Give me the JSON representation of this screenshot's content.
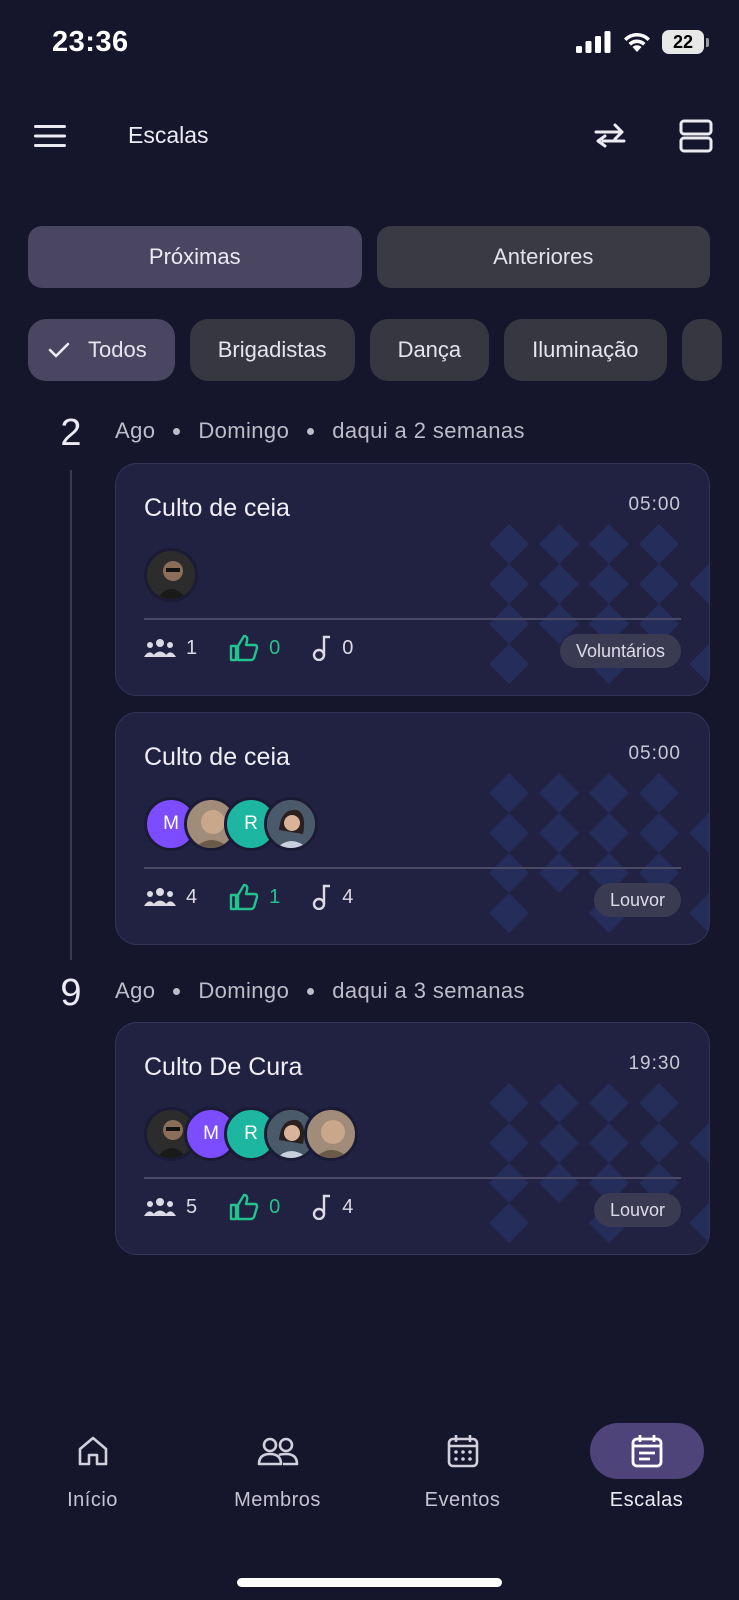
{
  "status_bar": {
    "time": "23:36",
    "battery": "22"
  },
  "app_bar": {
    "title": "Escalas"
  },
  "segments": [
    {
      "label": "Próximas",
      "active": true
    },
    {
      "label": "Anteriores",
      "active": false
    }
  ],
  "chips": [
    {
      "label": "Todos",
      "selected": true
    },
    {
      "label": "Brigadistas",
      "selected": false
    },
    {
      "label": "Dança",
      "selected": false
    },
    {
      "label": "Iluminação",
      "selected": false
    }
  ],
  "groups": [
    {
      "day": "2",
      "month": "Ago",
      "weekday": "Domingo",
      "relative": "daqui a 2 semanas",
      "cards": [
        {
          "title": "Culto de ceia",
          "time": "05:00",
          "avatars": [
            {
              "type": "photo",
              "initial": "",
              "color": "#3b3b3b"
            }
          ],
          "members": "1",
          "likes": "0",
          "songs": "0",
          "team": "Voluntários"
        },
        {
          "title": "Culto de ceia",
          "time": "05:00",
          "avatars": [
            {
              "type": "initial",
              "initial": "M",
              "color": "#7c4dff"
            },
            {
              "type": "photo",
              "initial": "",
              "color": "#8b7a6a"
            },
            {
              "type": "initial",
              "initial": "R",
              "color": "#1db6a0"
            },
            {
              "type": "photo",
              "initial": "",
              "color": "#5a6a7a"
            }
          ],
          "members": "4",
          "likes": "1",
          "songs": "4",
          "team": "Louvor"
        }
      ]
    },
    {
      "day": "9",
      "month": "Ago",
      "weekday": "Domingo",
      "relative": "daqui a 3 semanas",
      "cards": [
        {
          "title": "Culto De Cura",
          "time": "19:30",
          "avatars": [
            {
              "type": "photo",
              "initial": "",
              "color": "#3b3b3b"
            },
            {
              "type": "initial",
              "initial": "M",
              "color": "#7c4dff"
            },
            {
              "type": "initial",
              "initial": "R",
              "color": "#1db6a0"
            },
            {
              "type": "photo",
              "initial": "",
              "color": "#5a6a7a"
            },
            {
              "type": "photo",
              "initial": "",
              "color": "#8b7a6a"
            }
          ],
          "members": "5",
          "likes": "0",
          "songs": "4",
          "team": "Louvor"
        }
      ]
    }
  ],
  "bottom_nav": [
    {
      "label": "Início",
      "icon": "home-icon",
      "active": false
    },
    {
      "label": "Membros",
      "icon": "people-icon",
      "active": false
    },
    {
      "label": "Eventos",
      "icon": "calendar-icon",
      "active": false
    },
    {
      "label": "Escalas",
      "icon": "schedule-icon",
      "active": true
    }
  ],
  "colors": {
    "background": "#15152b",
    "card": "#212142",
    "accent": "#4f4479",
    "like_green": "#22c38e"
  }
}
